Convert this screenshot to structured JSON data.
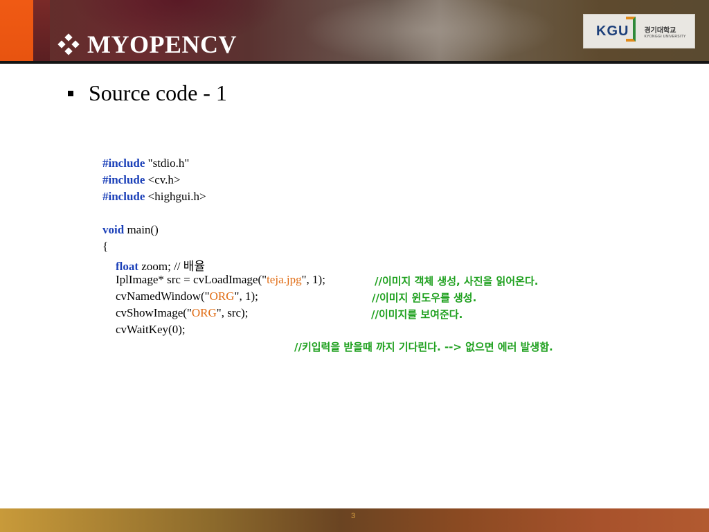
{
  "header": {
    "title": "MYOPENCV",
    "logo": {
      "mark": "KGU",
      "korean": "경기대학교",
      "english": "KYONGGI UNIVERSITY"
    }
  },
  "bullet": {
    "text": "Source code - 1"
  },
  "code": {
    "line1": {
      "kw": "#include",
      "rest": " \"stdio.h\""
    },
    "line2": {
      "kw": "#include",
      "rest": " <cv.h>"
    },
    "line3": {
      "kw": "#include",
      "rest": " <highgui.h>"
    },
    "line5": {
      "kw": "void",
      "rest": " main()"
    },
    "line6": "{",
    "line7": {
      "kw": "float",
      "rest": " zoom; // 배율"
    },
    "line8": {
      "pre": "IplImage* src = cvLoadImage(\"",
      "str": "teja.jpg",
      "post": "\", 1);"
    },
    "line9": {
      "pre": "cvNamedWindow(\"",
      "str": "ORG",
      "post": "\", 1);"
    },
    "line10": {
      "pre": "cvShowImage(\"",
      "str": "ORG",
      "post": "\", src);"
    },
    "line11": "cvWaitKey(0);",
    "comment1": "//이미지 객체 생성, 사진을 읽어온다.",
    "comment2": "//이미지 윈도우를 생성.",
    "comment3": "//이미지를 보여준다.",
    "comment4": "//키입력을 받을때 까지 기다린다. --> 없으면 에러 발생함."
  },
  "footer": {
    "page_number": "3"
  },
  "colors": {
    "keyword": "#1a3fb8",
    "string": "#e06a10",
    "comment": "#1ea01e"
  }
}
